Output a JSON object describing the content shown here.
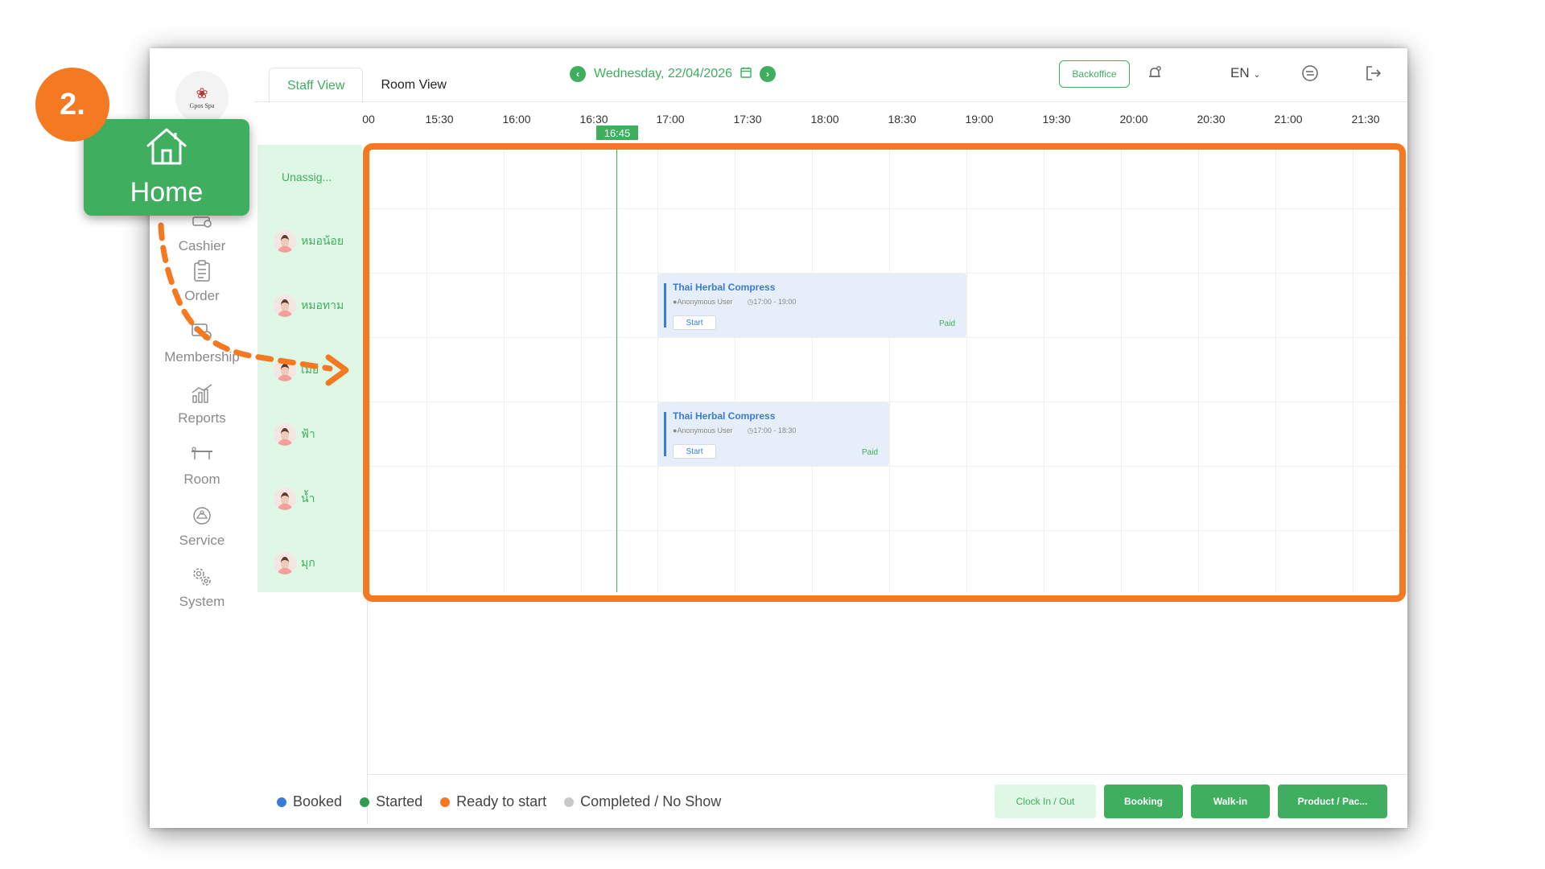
{
  "tutorial": {
    "step_label": "2.",
    "highlight_card_label": "Home",
    "accent_color": "#f47920"
  },
  "brand": {
    "logo_text": "Gpos Spa"
  },
  "sidebar": {
    "items": [
      {
        "label": "Cashier",
        "icon": "cashier-icon"
      },
      {
        "label": "Order",
        "icon": "clipboard-icon"
      },
      {
        "label": "Membership",
        "icon": "membership-card-icon"
      },
      {
        "label": "Reports",
        "icon": "bar-chart-icon"
      },
      {
        "label": "Room",
        "icon": "massage-bed-icon"
      },
      {
        "label": "Service",
        "icon": "lotus-icon"
      },
      {
        "label": "System",
        "icon": "gears-icon"
      }
    ]
  },
  "header": {
    "tabs": [
      {
        "label": "Staff View",
        "active": true
      },
      {
        "label": "Room View",
        "active": false
      }
    ],
    "date": "Wednesday, 22/04/2026",
    "backoffice_label": "Backoffice",
    "language": "EN",
    "brand_color": "#3fae5e"
  },
  "schedule": {
    "times": [
      "00",
      "15:30",
      "16:00",
      "16:30",
      "17:00",
      "17:30",
      "18:00",
      "18:30",
      "19:00",
      "19:30",
      "20:00",
      "20:30",
      "21:00",
      "21:30"
    ],
    "current_time": "16:45",
    "staff": [
      {
        "name": "Unassig...",
        "unassigned": true
      },
      {
        "name": "หมอน้อย"
      },
      {
        "name": "หมอทาม"
      },
      {
        "name": "เมย์"
      },
      {
        "name": "ฟ้า"
      },
      {
        "name": "น้ำ"
      },
      {
        "name": "มุก"
      }
    ],
    "bookings": [
      {
        "service": "Thai Herbal Compress",
        "customer": "Anonymous User",
        "time": "17:00 - 19:00",
        "action": "Start",
        "status": "Paid"
      },
      {
        "service": "Thai Herbal Compress",
        "customer": "Anonymous User",
        "time": "17:00 - 18:30",
        "action": "Start",
        "status": "Paid"
      }
    ]
  },
  "legend": [
    {
      "label": "Booked",
      "color": "#3a7bd5"
    },
    {
      "label": "Started",
      "color": "#2f9e52"
    },
    {
      "label": "Ready to start",
      "color": "#f47920"
    },
    {
      "label": "Completed / No Show",
      "color": "#c8c8c8"
    }
  ],
  "actions": [
    {
      "label": "Clock In / Out"
    },
    {
      "label": "Booking"
    },
    {
      "label": "Walk-in"
    },
    {
      "label": "Product / Pac..."
    }
  ]
}
